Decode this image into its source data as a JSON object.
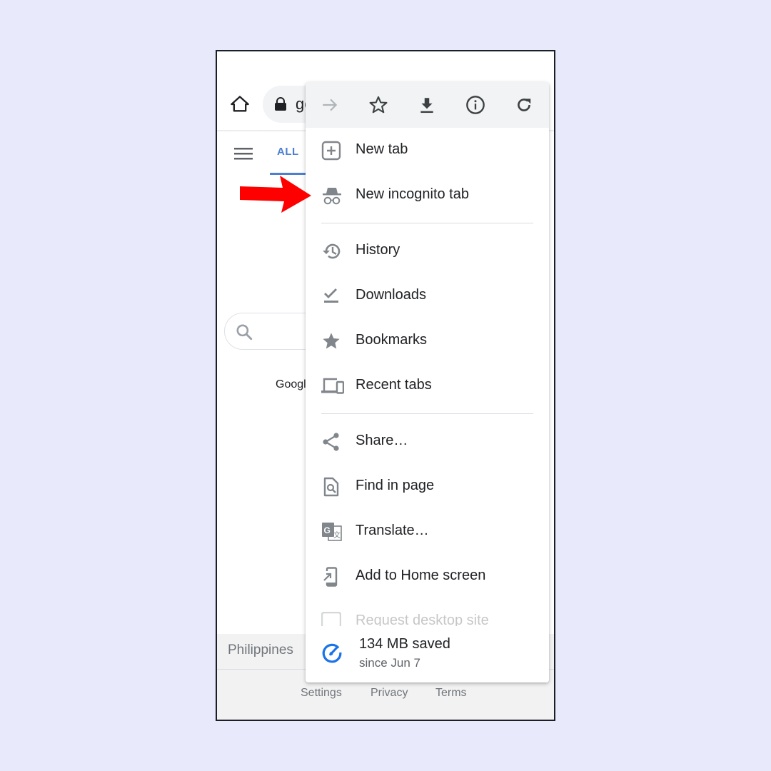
{
  "browser": {
    "url_partial": "go",
    "icons": {
      "home": "home-icon",
      "lock": "lock-icon"
    }
  },
  "page": {
    "tabs": [
      {
        "label": "ALL",
        "active": true
      }
    ],
    "google_offered_partial": "Googl",
    "footer": {
      "country": "Philippines",
      "links": [
        "Settings",
        "Privacy",
        "Terms"
      ]
    }
  },
  "menu": {
    "iconbar": [
      {
        "name": "forward",
        "icon": "arrow-right-icon",
        "enabled": false
      },
      {
        "name": "bookmark",
        "icon": "star-outline-icon",
        "enabled": true
      },
      {
        "name": "download",
        "icon": "download-icon",
        "enabled": true
      },
      {
        "name": "page-info",
        "icon": "info-icon",
        "enabled": true
      },
      {
        "name": "reload",
        "icon": "reload-icon",
        "enabled": true
      }
    ],
    "items": [
      {
        "label": "New tab",
        "icon": "new-tab-icon"
      },
      {
        "label": "New incognito tab",
        "icon": "incognito-icon"
      },
      {
        "label": "History",
        "icon": "history-icon"
      },
      {
        "label": "Downloads",
        "icon": "downloads-check-icon"
      },
      {
        "label": "Bookmarks",
        "icon": "star-icon"
      },
      {
        "label": "Recent tabs",
        "icon": "devices-icon"
      },
      {
        "label": "Share…",
        "icon": "share-icon"
      },
      {
        "label": "Find in page",
        "icon": "find-in-page-icon"
      },
      {
        "label": "Translate…",
        "icon": "translate-icon"
      },
      {
        "label": "Add to Home screen",
        "icon": "add-to-home-icon"
      },
      {
        "label": "Request desktop site",
        "icon": "checkbox-icon"
      }
    ],
    "data_saver": {
      "title": "134 MB saved",
      "subtitle": "since Jun 7",
      "icon": "speedometer-icon",
      "color": "#1a73e8"
    }
  },
  "annotation": {
    "arrow_color": "#ff0000",
    "points_to": "New incognito tab"
  },
  "colors": {
    "background": "#e8eafb",
    "accent": "#4c7fd2",
    "icon_gray": "#80868b",
    "text": "#202124"
  }
}
